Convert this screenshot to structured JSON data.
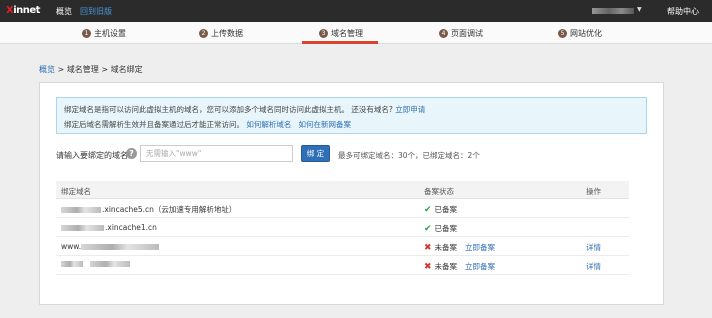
{
  "topbar": {
    "logo_x": "X",
    "logo_rest": "innet",
    "nav_overview": "概览",
    "nav_back": "回到旧版",
    "help": "帮助中心"
  },
  "steps": [
    {
      "num": "1",
      "label": "主机设置",
      "active": false
    },
    {
      "num": "2",
      "label": "上传数据",
      "active": false
    },
    {
      "num": "3",
      "label": "域名管理",
      "active": true
    },
    {
      "num": "4",
      "label": "页面调试",
      "active": false
    },
    {
      "num": "5",
      "label": "网站优化",
      "active": false
    }
  ],
  "breadcrumb": {
    "root": "概览",
    "sep": " > ",
    "middle": "域名管理",
    "current": "域名绑定"
  },
  "info": {
    "line1_text": "绑定域名是指可以访问此虚拟主机的域名，您可以添加多个域名同时访问此虚拟主机。 还没有域名?",
    "line1_link": "立即申请",
    "line2_text": "绑定后域名需解析生效并且备案通过后才能正常访问。",
    "line2_link1": "如何解析域名",
    "line2_link2": "如何在新网备案"
  },
  "bind": {
    "label": "请输入要绑定的域名:",
    "help_icon": "?",
    "placeholder": "无需输入\"www\"",
    "value": "",
    "button": "绑 定",
    "note": "最多可绑定域名：30个，已绑定域名：2个"
  },
  "table": {
    "headers": [
      "绑定域名",
      "备案状态",
      "操作"
    ],
    "rows": [
      {
        "domain_suffix": ".xincache5.cn（云加速专用解析地址）",
        "status": "已备案",
        "ok": true,
        "action": "",
        "detail": ""
      },
      {
        "domain_suffix": ".xincache1.cn",
        "status": "已备案",
        "ok": true,
        "action": "",
        "detail": ""
      },
      {
        "domain_prefix": "www.",
        "status": "未备案",
        "ok": false,
        "action": "立即备案",
        "detail": "详情"
      },
      {
        "status": "未备案",
        "ok": false,
        "action": "立即备案",
        "detail": "详情"
      }
    ]
  },
  "colors": {
    "accent": "#d9442c",
    "link": "#2e6db4",
    "button": "#2f6fb6",
    "ok": "#2aa04a",
    "bad": "#d9342c"
  },
  "icons": {
    "ok": "checkmark-icon",
    "bad": "cross-icon",
    "help": "question-icon"
  }
}
